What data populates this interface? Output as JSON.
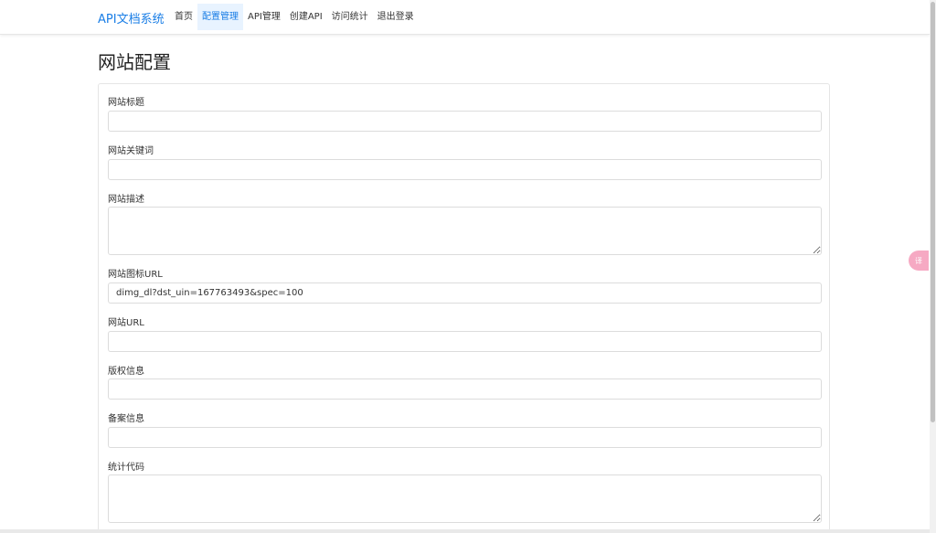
{
  "navbar": {
    "brand": "API文档系统",
    "items": [
      {
        "label": "首页",
        "active": false
      },
      {
        "label": "配置管理",
        "active": true
      },
      {
        "label": "API管理",
        "active": false
      },
      {
        "label": "创建API",
        "active": false
      },
      {
        "label": "访问统计",
        "active": false
      },
      {
        "label": "退出登录",
        "active": false
      }
    ]
  },
  "page": {
    "title": "网站配置"
  },
  "form": {
    "site_title": {
      "label": "网站标题",
      "value": ""
    },
    "keywords": {
      "label": "网站关键词",
      "value": ""
    },
    "description": {
      "label": "网站描述",
      "value": ""
    },
    "icon_url": {
      "label": "网站图标URL",
      "value": "dimg_dl?dst_uin=167763493&spec=100"
    },
    "site_url": {
      "label": "网站URL",
      "value": ""
    },
    "copyright": {
      "label": "版权信息",
      "value": ""
    },
    "icp": {
      "label": "备案信息",
      "value": ""
    },
    "analytics": {
      "label": "统计代码",
      "value": ""
    }
  },
  "floating_tool": {
    "label": "译",
    "icon": "translate-icon"
  },
  "colors": {
    "accent": "#1a7ee6",
    "active_bg": "#e8f3ff",
    "float_tool": "#f6a9c3"
  }
}
